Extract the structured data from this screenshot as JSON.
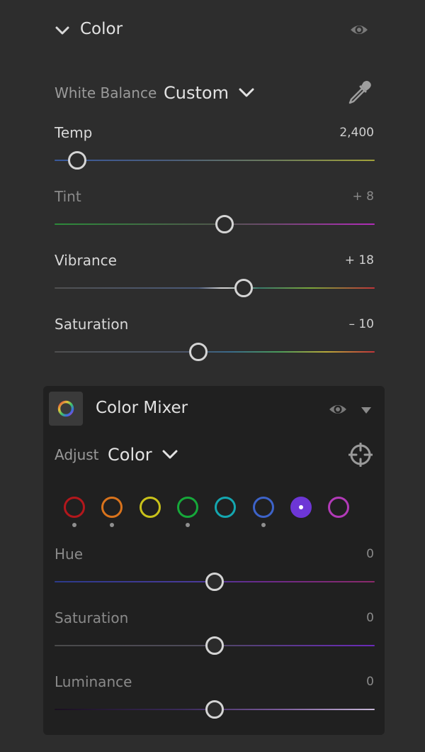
{
  "color_section": {
    "title": "Color",
    "white_balance": {
      "label": "White Balance",
      "value": "Custom"
    },
    "sliders": [
      {
        "label": "Temp",
        "value": "2,400",
        "level": 0.07
      },
      {
        "label": "Tint",
        "value": "+ 8",
        "level": 0.53
      },
      {
        "label": "Vibrance",
        "value": "+ 18",
        "level": 0.59
      },
      {
        "label": "Saturation",
        "value": "– 10",
        "level": 0.45
      }
    ]
  },
  "color_mixer": {
    "title": "Color Mixer",
    "adjust": {
      "label": "Adjust",
      "value": "Color"
    },
    "swatches": [
      {
        "color": "#b3171c",
        "name": "red"
      },
      {
        "color": "#d9731c",
        "name": "orange"
      },
      {
        "color": "#c9c21a",
        "name": "yellow"
      },
      {
        "color": "#16a83a",
        "name": "green"
      },
      {
        "color": "#14a7b0",
        "name": "aqua"
      },
      {
        "color": "#3d63c9",
        "name": "blue"
      },
      {
        "color": "#6d36d6",
        "name": "purple",
        "selected": true
      },
      {
        "color": "#b23ab8",
        "name": "magenta"
      }
    ],
    "sliders": [
      {
        "label": "Hue",
        "value": "0",
        "level": 0.5
      },
      {
        "label": "Saturation",
        "value": "0",
        "level": 0.5
      },
      {
        "label": "Luminance",
        "value": "0",
        "level": 0.5
      }
    ]
  },
  "colors": {
    "background": "#2d2d2d",
    "panel": "#202020",
    "thumb": "#d4d4d4",
    "selected_swatch": "#6d36d6"
  }
}
